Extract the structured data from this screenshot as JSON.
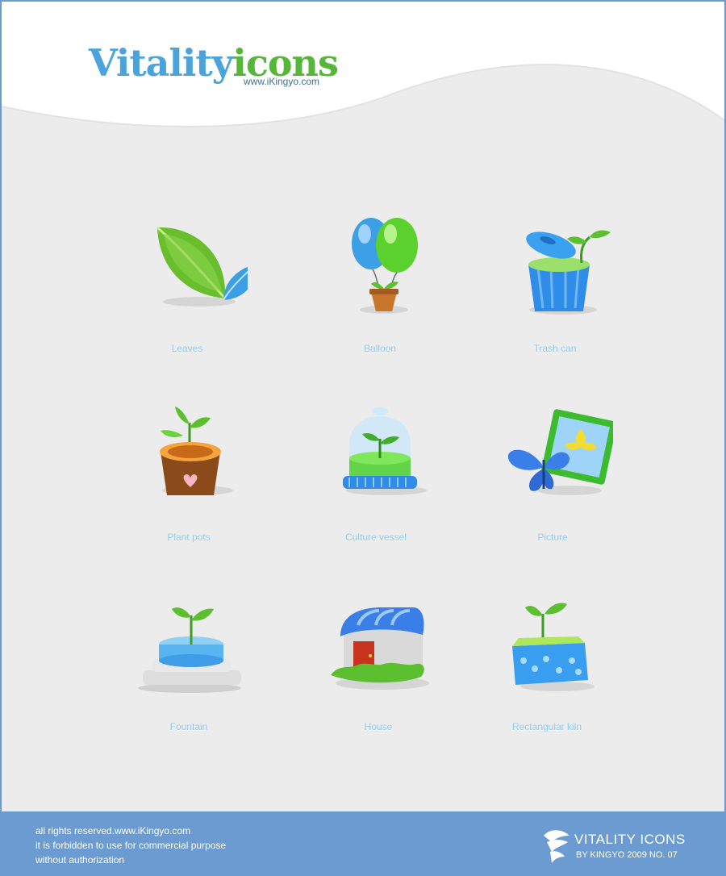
{
  "logo": {
    "word_part1": "Vitality",
    "word_part2": "icons",
    "url": "www.iKingyo.com"
  },
  "icons": [
    {
      "label": "Leaves",
      "icon": "leaves-icon"
    },
    {
      "label": "Balloon",
      "icon": "balloon-icon"
    },
    {
      "label": "Trash can",
      "icon": "trash-can-icon"
    },
    {
      "label": "Plant pots",
      "icon": "plant-pot-icon"
    },
    {
      "label": "Culture vessel",
      "icon": "culture-vessel-icon"
    },
    {
      "label": "Picture",
      "icon": "picture-icon"
    },
    {
      "label": "Fountain",
      "icon": "fountain-icon"
    },
    {
      "label": "House",
      "icon": "house-icon"
    },
    {
      "label": "Rectangular kiln",
      "icon": "rectangular-kiln-icon"
    }
  ],
  "footer": {
    "line1": "all rights reserved.www.iKingyo.com",
    "line2": "it is forbidden to use for commercial purpose",
    "line3": "without authorization",
    "brand_title": "VITALITY ICONS",
    "brand_sub": "BY KINGYO 2009 NO. 07"
  },
  "colors": {
    "accent_blue": "#4aa3dc",
    "accent_green": "#55b63a",
    "footer_bg": "#6b9bd0",
    "label_text": "#8ec8ea",
    "page_bg": "#ececec"
  }
}
